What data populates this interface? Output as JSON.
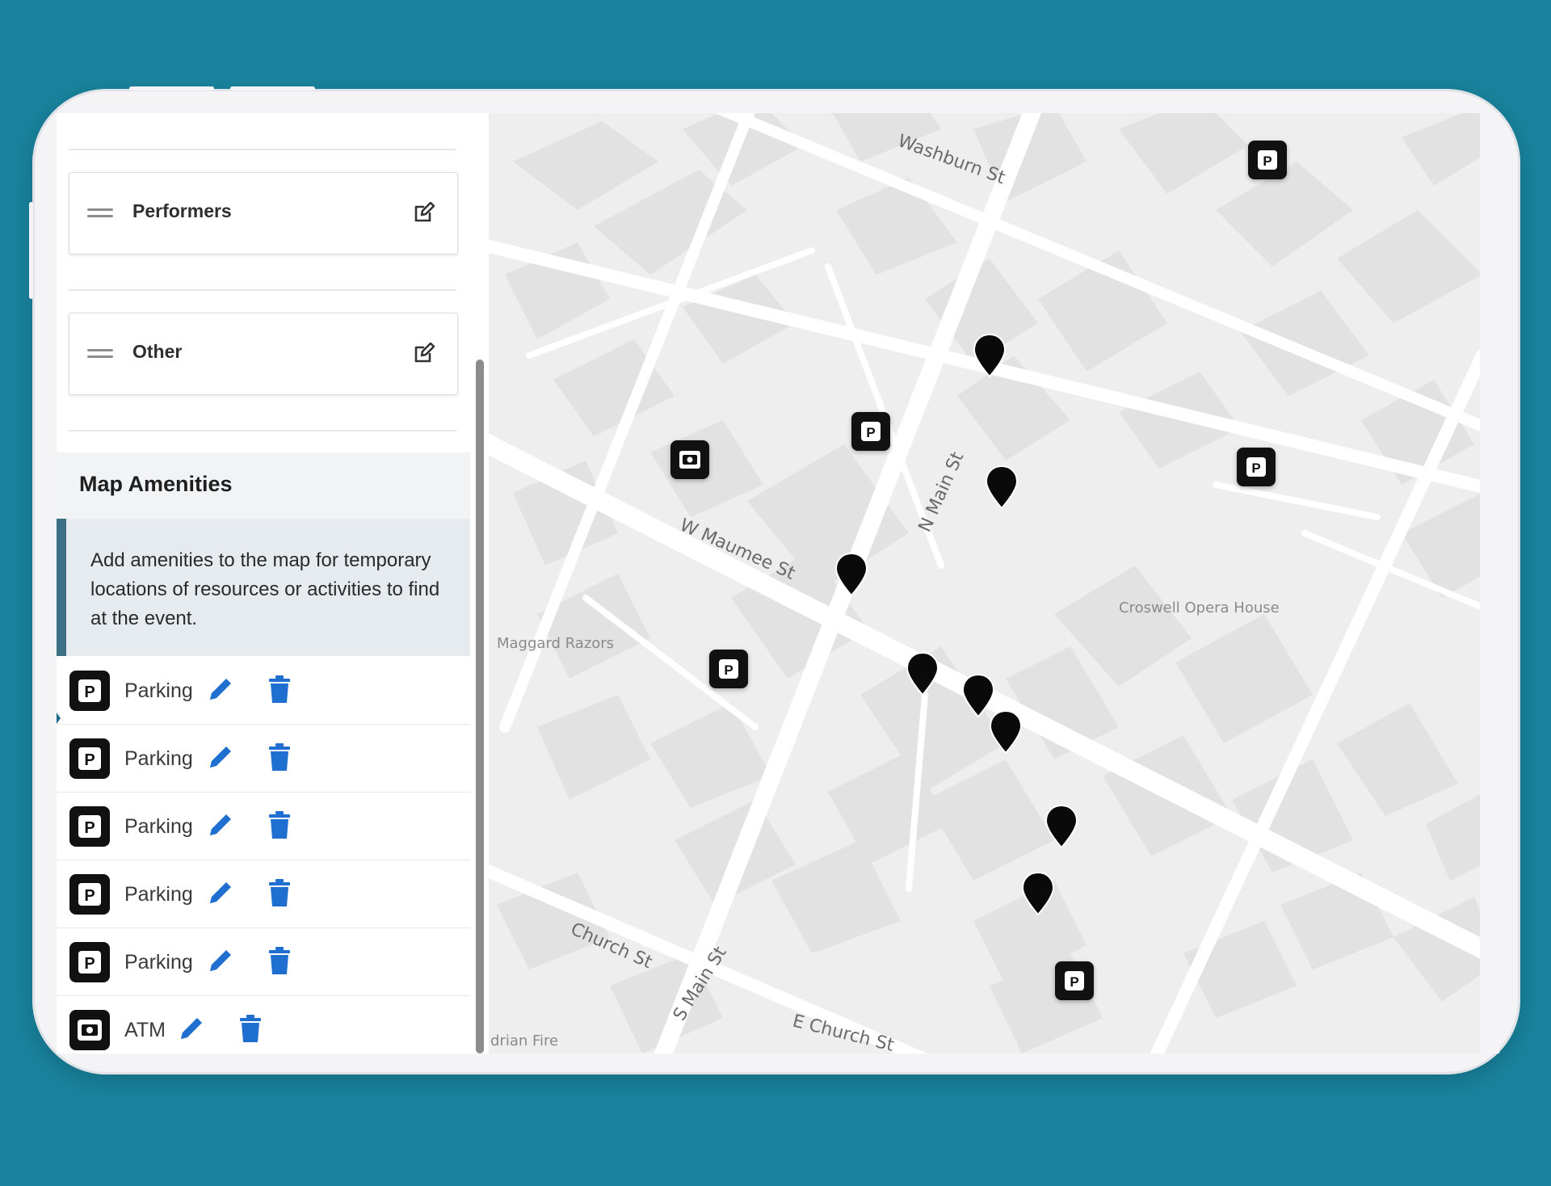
{
  "sidebar": {
    "sections": [
      {
        "title": "Performers"
      },
      {
        "title": "Other"
      }
    ],
    "amenities": {
      "title": "Map Amenities",
      "info": "Add amenities to the map for temporary locations of resources or activities to find at the event.",
      "items": [
        {
          "label": "Parking",
          "icon": "parking-icon"
        },
        {
          "label": "Parking",
          "icon": "parking-icon"
        },
        {
          "label": "Parking",
          "icon": "parking-icon"
        },
        {
          "label": "Parking",
          "icon": "parking-icon"
        },
        {
          "label": "Parking",
          "icon": "parking-icon"
        },
        {
          "label": "ATM",
          "icon": "atm-icon"
        }
      ]
    }
  },
  "map": {
    "streets": {
      "washburn": "Washburn St",
      "n_main": "N Main St",
      "w_maumee": "W Maumee St",
      "church": "Church St",
      "s_main": "S Main St",
      "e_church": "E Church St"
    },
    "places": {
      "opera": "Croswell Opera House",
      "razors": "Maggard Razors",
      "fire": "drian Fire"
    }
  },
  "colors": {
    "background": "#19839d",
    "accent_blue": "#1f6fd1",
    "info_border": "#3d6f85"
  }
}
